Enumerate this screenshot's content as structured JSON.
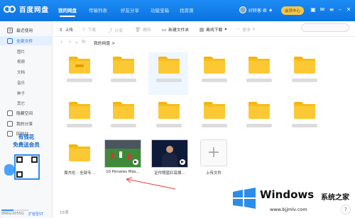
{
  "app": {
    "title": "百度网盘"
  },
  "nav": {
    "tabs": [
      "我的网盘",
      "传输列表",
      "好友分享",
      "功能宝箱",
      "找资源"
    ]
  },
  "user": {
    "name": "好转客·君",
    "vip_label": "会员中心"
  },
  "sidebar": {
    "items": [
      {
        "label": "最近使用",
        "icon": "clock-icon"
      },
      {
        "label": "全部文件",
        "icon": "folder-icon"
      }
    ],
    "subitems": [
      "图片",
      "视频",
      "文档",
      "音乐",
      "种子",
      "其它"
    ],
    "items2": [
      {
        "label": "隐藏空间",
        "icon": "lock-icon"
      },
      {
        "label": "我的分享",
        "icon": "share-icon"
      },
      {
        "label": "回收站",
        "icon": "trash-icon"
      }
    ],
    "promo": {
      "line1": "有钱花",
      "line2": "免费送会员"
    },
    "storage": {
      "used": "896G/2055G",
      "expand": "扩容至5T",
      "fraction": 0.44
    }
  },
  "toolbar": {
    "upload": "上传",
    "download": "下载",
    "share": "分享",
    "delete": "删除",
    "new_folder": "新建文件夹",
    "offline_download": "离线下载",
    "more": "更多"
  },
  "breadcrumb": {
    "path": "我的网盘",
    "sep": ">"
  },
  "files": {
    "row3": [
      {
        "name": "周杰伦 - 全部专...",
        "type": "folder"
      },
      {
        "name": "10 Penales Más...",
        "type": "video"
      },
      {
        "name": "证件照蓝红底换...",
        "type": "video"
      },
      {
        "name": "上传文件",
        "type": "upload"
      }
    ]
  },
  "status": {
    "count": "15项"
  },
  "watermark": {
    "brand": "Windows",
    "cn": "系统之家",
    "url": "www.bjjmlv.com"
  },
  "colors": {
    "accent": "#1a73e8",
    "folder": "#fcc935",
    "topbar": "#0a73e0"
  }
}
